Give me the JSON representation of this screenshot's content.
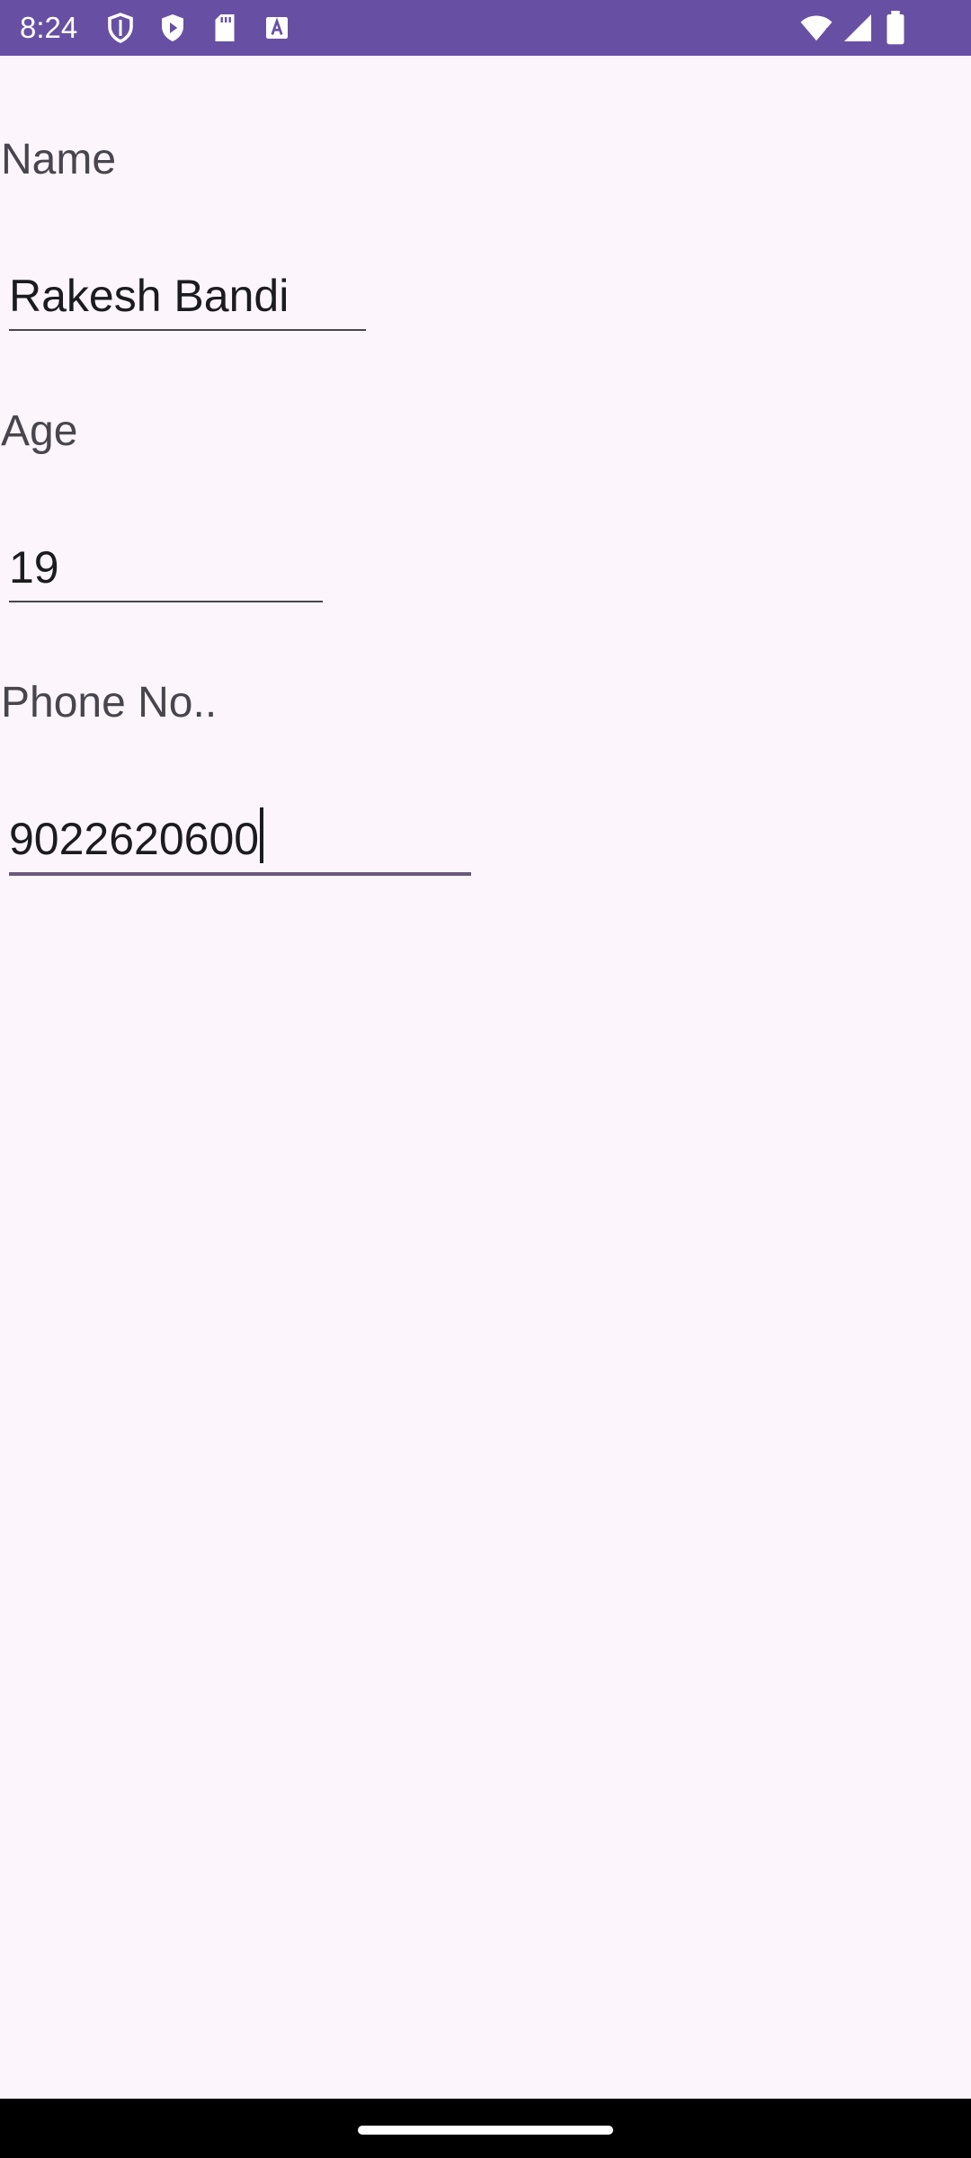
{
  "status_bar": {
    "time": "8:24",
    "left_icons": [
      "shield-icon",
      "play-protect-icon",
      "sd-card-icon",
      "font-a-icon"
    ],
    "right_icons": [
      "wifi-icon",
      "signal-icon",
      "battery-icon"
    ],
    "background": "#6750A4"
  },
  "form": {
    "name": {
      "label": "Name",
      "value": "Rakesh Bandi"
    },
    "age": {
      "label": "Age",
      "value": "19"
    },
    "phone": {
      "label": "Phone No..",
      "value": "9022620600"
    }
  },
  "colors": {
    "background": "#FCF6FC",
    "label": "#49454E",
    "text": "#1C1B1F",
    "accent": "#6750A4"
  }
}
